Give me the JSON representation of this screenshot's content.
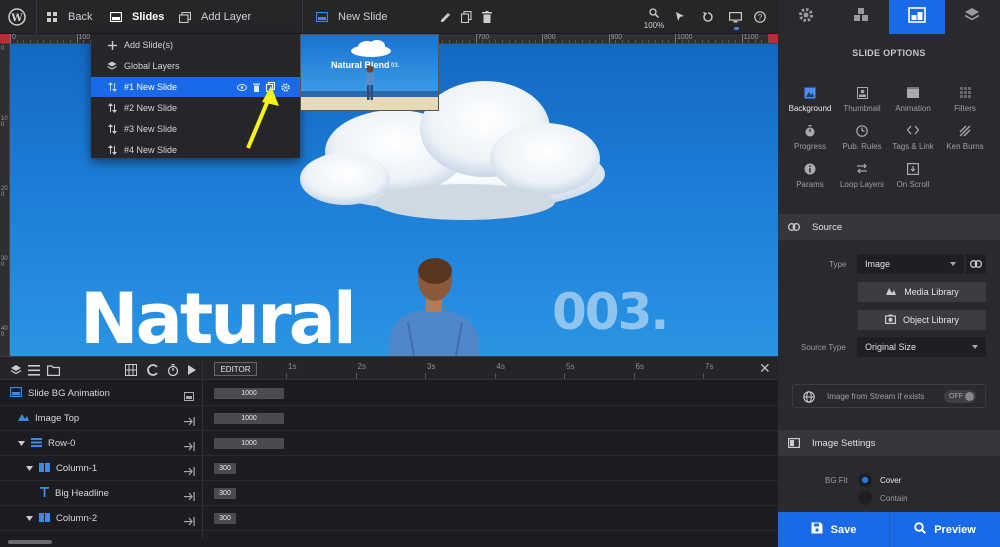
{
  "topbar": {
    "back_label": "Back",
    "slides_label": "Slides",
    "add_layer_label": "Add Layer",
    "current_slide_label": "New Slide",
    "zoom_level": "100%"
  },
  "ruler": {
    "top_marks": [
      "0",
      "100",
      "200",
      "300",
      "400",
      "500",
      "600",
      "700",
      "800",
      "900",
      "1000",
      "1100"
    ],
    "left_marks": [
      "0",
      "100",
      "200",
      "300",
      "400"
    ]
  },
  "canvas": {
    "headline": "Natural",
    "number_text": "003."
  },
  "slides_menu": {
    "items": [
      {
        "label": "Add Slide(s)",
        "icon": "plus-icon"
      },
      {
        "label": "Global Layers",
        "icon": "layers-icon"
      },
      {
        "label": "#1 New Slide",
        "icon": "sort-icon",
        "active": true
      },
      {
        "label": "#2 New Slide",
        "icon": "sort-icon"
      },
      {
        "label": "#3 New Slide",
        "icon": "sort-icon"
      },
      {
        "label": "#4 New Slide",
        "icon": "sort-icon"
      }
    ],
    "thumbnail_title": "Natural Blend",
    "thumbnail_number": "03."
  },
  "timeline": {
    "editor_label": "EDITOR",
    "ticks": [
      "1s",
      "2s",
      "3s",
      "4s",
      "5s",
      "6s",
      "7s"
    ],
    "rows": [
      {
        "label": "Slide BG Animation",
        "bar": "1000"
      },
      {
        "label": "Image Top",
        "bar": "1000"
      },
      {
        "label": "Row-0",
        "bar": "1000"
      },
      {
        "label": "Column-1",
        "bar": "300"
      },
      {
        "label": "Big Headline",
        "bar": "300"
      },
      {
        "label": "Column-2",
        "bar": "300"
      }
    ]
  },
  "panel": {
    "title": "SLIDE OPTIONS",
    "options": [
      {
        "label": "Background",
        "active": true
      },
      {
        "label": "Thumbnail"
      },
      {
        "label": "Animation"
      },
      {
        "label": "Filters"
      },
      {
        "label": "Progress"
      },
      {
        "label": "Pub. Rules"
      },
      {
        "label": "Tags & Link"
      },
      {
        "label": "Ken Burns"
      },
      {
        "label": "Params"
      },
      {
        "label": "Loop Layers"
      },
      {
        "label": "On Scroll"
      }
    ],
    "source_section": "Source",
    "type_label": "Type",
    "type_value": "Image",
    "media_library": "Media Library",
    "object_library": "Object Library",
    "source_type_label": "Source Type",
    "source_type_value": "Original Size",
    "stream_label": "Image from Stream if exists",
    "stream_toggle": "OFF",
    "image_settings_section": "Image Settings",
    "bg_fit_label": "BG Fit",
    "bg_fit_cover": "Cover",
    "bg_fit_contain": "Contain"
  },
  "footer": {
    "save_label": "Save",
    "preview_label": "Preview"
  },
  "colors": {
    "accent": "#1a6ae8",
    "annotation_arrow": "#f4f41a",
    "ruler_highlight": "#c0293a"
  }
}
